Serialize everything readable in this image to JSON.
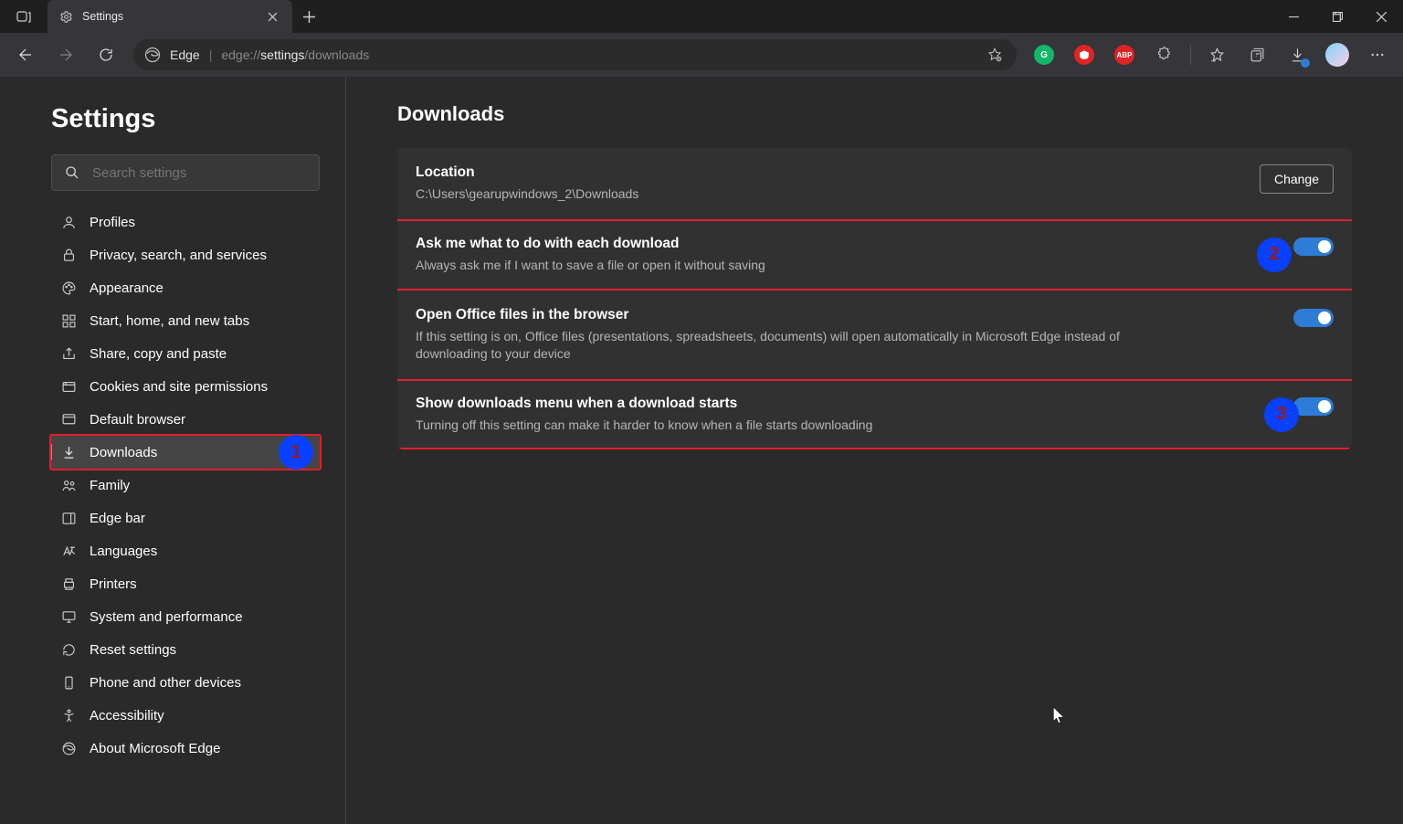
{
  "titlebar": {
    "tab_title": "Settings"
  },
  "address": {
    "label": "Edge",
    "url_proto": "edge://",
    "url_host": "settings",
    "url_path": "/downloads"
  },
  "sidebar": {
    "heading": "Settings",
    "search_placeholder": "Search settings",
    "items": [
      {
        "label": "Profiles"
      },
      {
        "label": "Privacy, search, and services"
      },
      {
        "label": "Appearance"
      },
      {
        "label": "Start, home, and new tabs"
      },
      {
        "label": "Share, copy and paste"
      },
      {
        "label": "Cookies and site permissions"
      },
      {
        "label": "Default browser"
      },
      {
        "label": "Downloads"
      },
      {
        "label": "Family"
      },
      {
        "label": "Edge bar"
      },
      {
        "label": "Languages"
      },
      {
        "label": "Printers"
      },
      {
        "label": "System and performance"
      },
      {
        "label": "Reset settings"
      },
      {
        "label": "Phone and other devices"
      },
      {
        "label": "Accessibility"
      },
      {
        "label": "About Microsoft Edge"
      }
    ]
  },
  "main": {
    "heading": "Downloads",
    "location": {
      "title": "Location",
      "path": "C:\\Users\\gearupwindows_2\\Downloads",
      "change": "Change"
    },
    "rows": [
      {
        "title": "Ask me what to do with each download",
        "desc": "Always ask me if I want to save a file or open it without saving"
      },
      {
        "title": "Open Office files in the browser",
        "desc": "If this setting is on, Office files (presentations, spreadsheets, documents) will open automatically in Microsoft Edge instead of downloading to your device"
      },
      {
        "title": "Show downloads menu when a download starts",
        "desc": "Turning off this setting can make it harder to know when a file starts downloading"
      }
    ]
  },
  "annotations": {
    "n1": "1",
    "n2": "2",
    "n3": "3"
  },
  "ext": {
    "g": "G",
    "abp": "ABP"
  }
}
